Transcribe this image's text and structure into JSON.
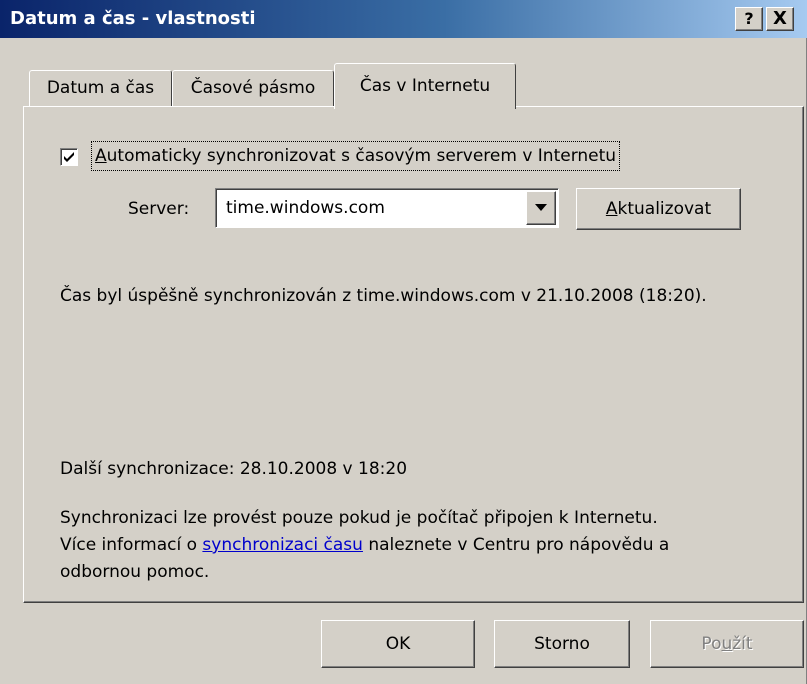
{
  "window": {
    "title": "Datum a čas - vlastnosti",
    "help_button": "?",
    "close_button": "X"
  },
  "tabs": [
    {
      "label": "Datum a čas",
      "selected": false
    },
    {
      "label": "Časové pásmo",
      "selected": false
    },
    {
      "label": "Čas v Internetu",
      "selected": true
    }
  ],
  "sync": {
    "checkbox_checked": true,
    "checkbox_label_accel": "A",
    "checkbox_label_rest": "utomaticky synchronizovat s časovým serverem v Internetu",
    "server_label": "Server:",
    "server_value": "time.windows.com",
    "update_button_accel": "A",
    "update_button_rest": "ktualizovat",
    "status_text": "Čas byl úspěšně synchronizován z time.windows.com v 21.10.2008 (18:20).",
    "next_sync": "Další synchronizace: 28.10.2008 v 18:20",
    "info_line1": "Synchronizaci lze provést pouze pokud je počítač připojen k Internetu.",
    "info_line2_before": "Více informací o ",
    "info_link": "synchronizaci času",
    "info_line2_after": " naleznete v Centru pro nápovědu a",
    "info_line3": "odbornou pomoc."
  },
  "footer": {
    "ok_label": "OK",
    "cancel_label": "Storno",
    "apply_label_before": "Po",
    "apply_label_accel": "u",
    "apply_label_after": "žít",
    "apply_disabled": true
  }
}
